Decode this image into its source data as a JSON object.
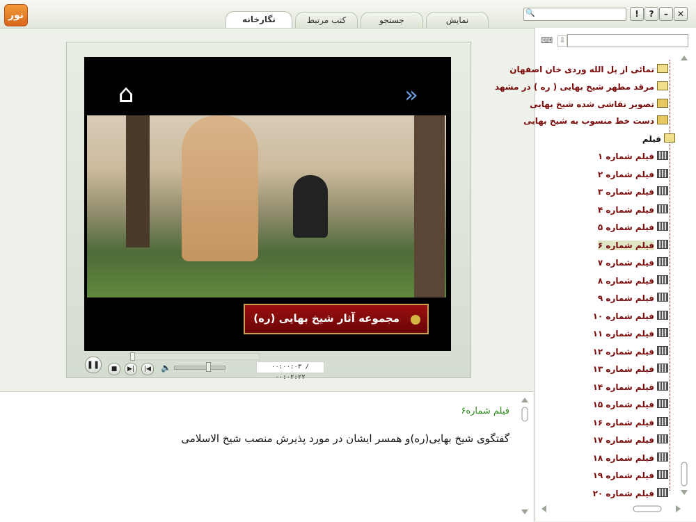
{
  "app": {
    "logo_text": "نور"
  },
  "tabs": [
    {
      "label": "نمایش",
      "active": false
    },
    {
      "label": "جستجو",
      "active": false
    },
    {
      "label": "کتب مرتبط",
      "active": false
    },
    {
      "label": "نگارخانه",
      "active": true
    }
  ],
  "window_buttons": {
    "alert": "!",
    "help": "?",
    "minimize": "–",
    "close": "✕"
  },
  "video": {
    "caption": "مجموعه آثار شیخ بهایی (ره)",
    "time": "۰۰:۰۰:۰۳ / ۰۰:۰۲:۲۲"
  },
  "description": {
    "title": "فیلم شماره۶",
    "body": "گفتگوی شیخ بهایی(ره)و همسر ایشان در مورد پذیرش منصب شیخ الاسلامی"
  },
  "tree": {
    "items": [
      {
        "label": "نمائی از پل الله وردی خان اصفهان",
        "icon": "folder-icon"
      },
      {
        "label": "مرقد مطهر شیخ بهایی ( ره ) در مشهد",
        "icon": "folder-icon"
      },
      {
        "label": "تصویر نقاشی شده شیخ بهایی",
        "icon": "photo-icon"
      },
      {
        "label": "دست خط منسوب به شیخ بهایی",
        "icon": "photo-icon"
      }
    ],
    "film_folder": "فیلم",
    "films": [
      "فیلم  شماره ۱",
      "فیلم  شماره ۲",
      "فیلم  شماره ۳",
      "فیلم  شماره ۴",
      "فیلم  شماره ۵",
      "فیلم  شماره ۶",
      "فیلم  شماره ۷",
      "فیلم  شماره ۸",
      "فیلم  شماره ۹",
      "فیلم  شماره ۱۰",
      "فیلم  شماره ۱۱",
      "فیلم  شماره ۱۲",
      "فیلم  شماره ۱۳",
      "فیلم  شماره ۱۴",
      "فیلم  شماره ۱۵",
      "فیلم  شماره ۱۶",
      "فیلم  شماره ۱۷",
      "فیلم  شماره ۱۸",
      "فیلم  شماره ۱۹",
      "فیلم  شماره ۲۰"
    ],
    "selected_index": 5
  },
  "colors": {
    "tree_text": "#7a0a0a",
    "desc_title": "#2a8a1a",
    "caption_bg": "#8a0a0a"
  }
}
